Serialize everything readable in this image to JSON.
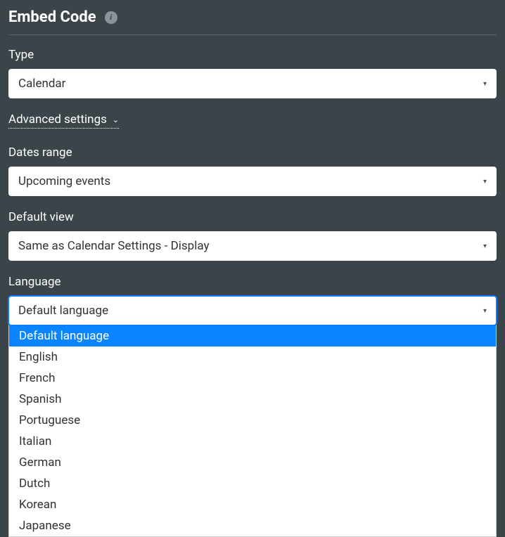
{
  "header": {
    "title": "Embed Code"
  },
  "type": {
    "label": "Type",
    "value": "Calendar"
  },
  "advanced": {
    "label": "Advanced settings"
  },
  "datesRange": {
    "label": "Dates range",
    "value": "Upcoming events"
  },
  "defaultView": {
    "label": "Default view",
    "value": "Same as Calendar Settings - Display"
  },
  "language": {
    "label": "Language",
    "value": "Default language",
    "options": [
      "Default language",
      "English",
      "French",
      "Spanish",
      "Portuguese",
      "Italian",
      "German",
      "Dutch",
      "Korean",
      "Japanese"
    ],
    "selectedIndex": 0
  }
}
